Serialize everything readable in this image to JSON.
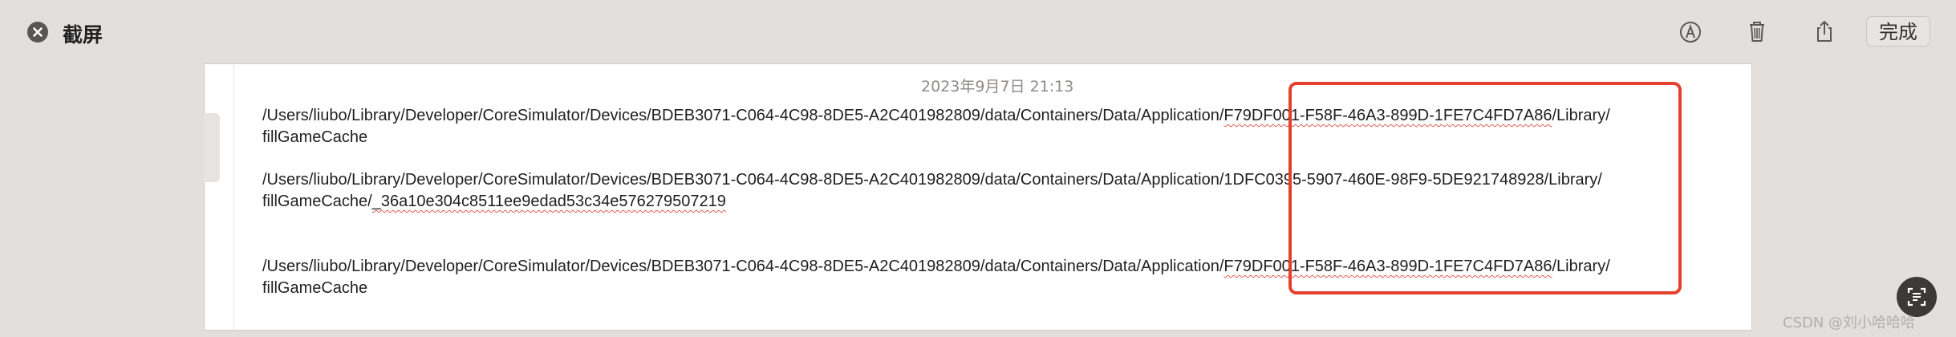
{
  "header": {
    "title": "截屏",
    "done_label": "完成",
    "close_icon": "close-circle-icon",
    "tools": [
      "markup-icon",
      "trash-icon",
      "share-icon"
    ]
  },
  "content": {
    "timestamp": "2023年9月7日 21:13",
    "entries": [
      {
        "line1_prefix": "/Users/liubo/Library/Developer/CoreSimulator/Devices/BDEB3071-C064-4C98-8DE5-A2C401982809/data/Containers/Data/Application/",
        "line1_id": "F79DF001-F58F-46A3-899D-1FE7C4FD7A86",
        "line1_suffix": "/Library/",
        "line2_prefix": "fillGameCache",
        "line2_suffix": ""
      },
      {
        "line1_prefix": "/Users/liubo/Library/Developer/CoreSimulator/Devices/BDEB3071-C064-4C98-8DE5-A2C401982809/data/Containers/Data/Application/",
        "line1_id": "1DFC0395-5907-460E-98F9-5DE921748928",
        "line1_suffix": "/Library/",
        "line2_prefix": "fillGameCache/",
        "line2_suffix": "_36a10e304c8511ee9edad53c34e576279507219"
      },
      {
        "line1_prefix": "/Users/liubo/Library/Developer/CoreSimulator/Devices/BDEB3071-C064-4C98-8DE5-A2C401982809/data/Containers/Data/Application/",
        "line1_id": "F79DF001-F58F-46A3-899D-1FE7C4FD7A86",
        "line1_suffix": "/Library/",
        "line2_prefix": "fillGameCache",
        "line2_suffix": ""
      }
    ]
  },
  "annotation": {
    "color": "#e4402d"
  },
  "footer": {
    "ocr_icon": "live-text-icon",
    "watermark": "CSDN @刘小哈哈哈"
  }
}
